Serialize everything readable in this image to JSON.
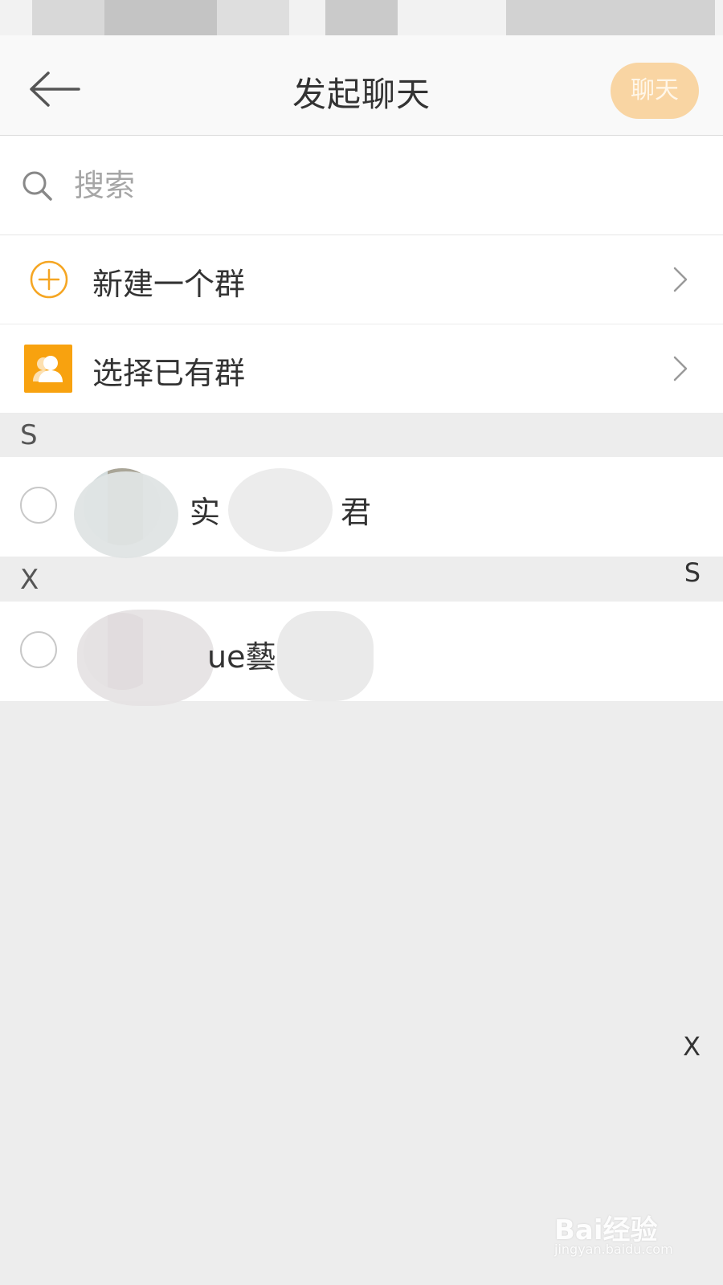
{
  "header": {
    "title": "发起聊天",
    "chat_button": "聊天",
    "accent_color": "#f9d5a3"
  },
  "search": {
    "placeholder": "搜索"
  },
  "menu": [
    {
      "label": "新建一个群",
      "icon": "plus-circle-icon"
    },
    {
      "label": "选择已有群",
      "icon": "group-icon"
    }
  ],
  "sections": [
    {
      "letter": "S",
      "contacts": [
        {
          "name": "实",
          "name_tail": "君"
        }
      ]
    },
    {
      "letter": "X",
      "contacts": [
        {
          "name": "ue藝"
        }
      ]
    }
  ],
  "index_bar": [
    "S",
    "X"
  ],
  "watermark": {
    "text": "Bai经验",
    "sub": "jingyan.baidu.com"
  }
}
